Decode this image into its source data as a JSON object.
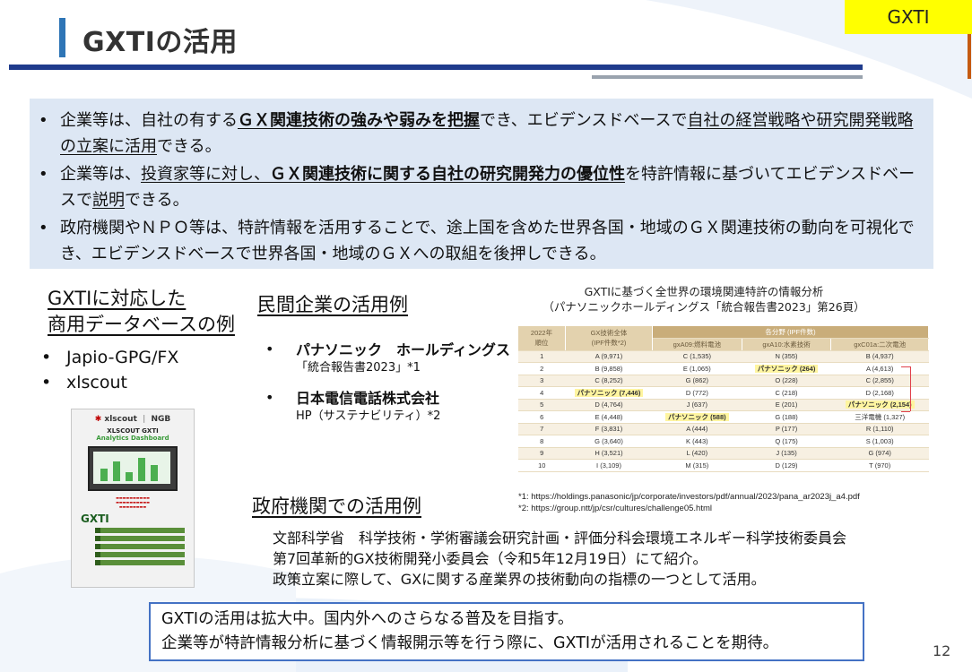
{
  "header": {
    "title": "GXTIの活用",
    "tag": "GXTI"
  },
  "summary": [
    {
      "parts": [
        {
          "t": "企業等は、自社の有する",
          "s": ""
        },
        {
          "t": "ＧＸ関連技術の強みや弱みを把握",
          "s": "bu"
        },
        {
          "t": "でき、エビデンスドベースで",
          "s": ""
        },
        {
          "t": "自社の経営戦略や研究開発戦略の立案に活用",
          "s": "u"
        },
        {
          "t": "できる。",
          "s": ""
        }
      ]
    },
    {
      "parts": [
        {
          "t": "企業等は、",
          "s": ""
        },
        {
          "t": "投資家等に対し、",
          "s": "u"
        },
        {
          "t": "ＧＸ関連技術に関する自社の研究開発力の優位性",
          "s": "bu"
        },
        {
          "t": "を特許情報に基づいてエビデンスドベースで",
          "s": ""
        },
        {
          "t": "説明",
          "s": "u"
        },
        {
          "t": "できる。",
          "s": ""
        }
      ]
    },
    {
      "parts": [
        {
          "t": "政府機関やＮＰＯ等は、特許情報を活用することで、途上国を含めた世界各国・地域のＧＸ関連技術の動向を可視化でき、エビデンスドベースで世界各国・地域のＧＸへの取組を後押しできる。",
          "s": ""
        }
      ]
    }
  ],
  "databases": {
    "heading_line1": "GXTIに対応した",
    "heading_line2": "商用データベースの例",
    "items": [
      "Japio-GPG/FX",
      "xlscout"
    ],
    "thumbnail": {
      "logo_left": "xlscout",
      "logo_right": "NGB",
      "title_line1": "XLSCOUT GXTI",
      "title_line2": "Analytics Dashboard",
      "badge": "GXTI"
    }
  },
  "companies": {
    "heading": "民間企業の活用例",
    "items": [
      {
        "name": "パナソニック　ホールディングス",
        "sub": "「統合報告書2023」*1"
      },
      {
        "name": "日本電信電話株式会社",
        "sub": "HP（サステナビリティ）*2"
      }
    ]
  },
  "figure": {
    "caption_line1": "GXTIに基づく全世界の環境関連特許の情報分析",
    "caption_line2": "（パナソニックホールディングス「統合報告書2023」第26頁）",
    "head_rank": "2022年\n順位",
    "head_total": "GX技術全体\n(IPF件数*2)",
    "head_field": "各分野 (IPF件数)",
    "columns": [
      "gxA09:燃料電池",
      "gxA10:水素技術",
      "gxC01a:二次電池"
    ],
    "rows": [
      {
        "rank": "1",
        "total": "A (9,971)",
        "c1": "C (1,535)",
        "c2": "N (355)",
        "c3": "B (4,937)",
        "hl": ""
      },
      {
        "rank": "2",
        "total": "B (9,858)",
        "c1": "E (1,065)",
        "c2": "パナソニック (264)",
        "c3": "A (4,613)",
        "hl": "c2"
      },
      {
        "rank": "3",
        "total": "C (8,252)",
        "c1": "G (862)",
        "c2": "O (228)",
        "c3": "C (2,855)",
        "hl": ""
      },
      {
        "rank": "4",
        "total": "パナソニック (7,446)",
        "c1": "D (772)",
        "c2": "C (218)",
        "c3": "D (2,168)",
        "hl": "total"
      },
      {
        "rank": "5",
        "total": "D (4,764)",
        "c1": "J (637)",
        "c2": "E (201)",
        "c3": "パナソニック (2,154)",
        "hl": "c3"
      },
      {
        "rank": "6",
        "total": "E (4,448)",
        "c1": "パナソニック (588)",
        "c2": "G (188)",
        "c3": "三洋電機 (1,327)",
        "hl": "c1"
      },
      {
        "rank": "7",
        "total": "F (3,831)",
        "c1": "A (444)",
        "c2": "P (177)",
        "c3": "R (1,110)",
        "hl": ""
      },
      {
        "rank": "8",
        "total": "G (3,640)",
        "c1": "K (443)",
        "c2": "Q (175)",
        "c3": "S (1,003)",
        "hl": ""
      },
      {
        "rank": "9",
        "total": "H (3,521)",
        "c1": "L (420)",
        "c2": "J (135)",
        "c3": "G (974)",
        "hl": ""
      },
      {
        "rank": "10",
        "total": "I (3,109)",
        "c1": "M (315)",
        "c2": "D (129)",
        "c3": "T (970)",
        "hl": ""
      }
    ],
    "note1": "*1:  https://holdings.panasonic/jp/corporate/investors/pdf/annual/2023/pana_ar2023j_a4.pdf",
    "note2": "*2:  https://group.ntt/jp/csr/cultures/challenge05.html"
  },
  "government": {
    "heading": "政府機関での活用例",
    "line1": "文部科学省　科学技術・学術審議会研究計画・評価分科会環境エネルギー科学技術委員会",
    "line2": "第7回革新的GX技術開発小委員会（令和5年12月19日）にて紹介。",
    "line3": "政策立案に際して、GXに関する産業界の技術動向の指標の一つとして活用。"
  },
  "callout": {
    "line1": "GXTIの活用は拡大中。国内外へのさらなる普及を目指す。",
    "line2": "企業等が特許情報分析に基づく情報開示等を行う際に、GXTIが活用されることを期待。"
  },
  "page_number": "12",
  "colors": {
    "accent": "#2e75b6",
    "rule": "#1f3b8c",
    "tag": "#ffff00",
    "summary_bg": "#dde7f4",
    "callout_border": "#4472c4"
  }
}
